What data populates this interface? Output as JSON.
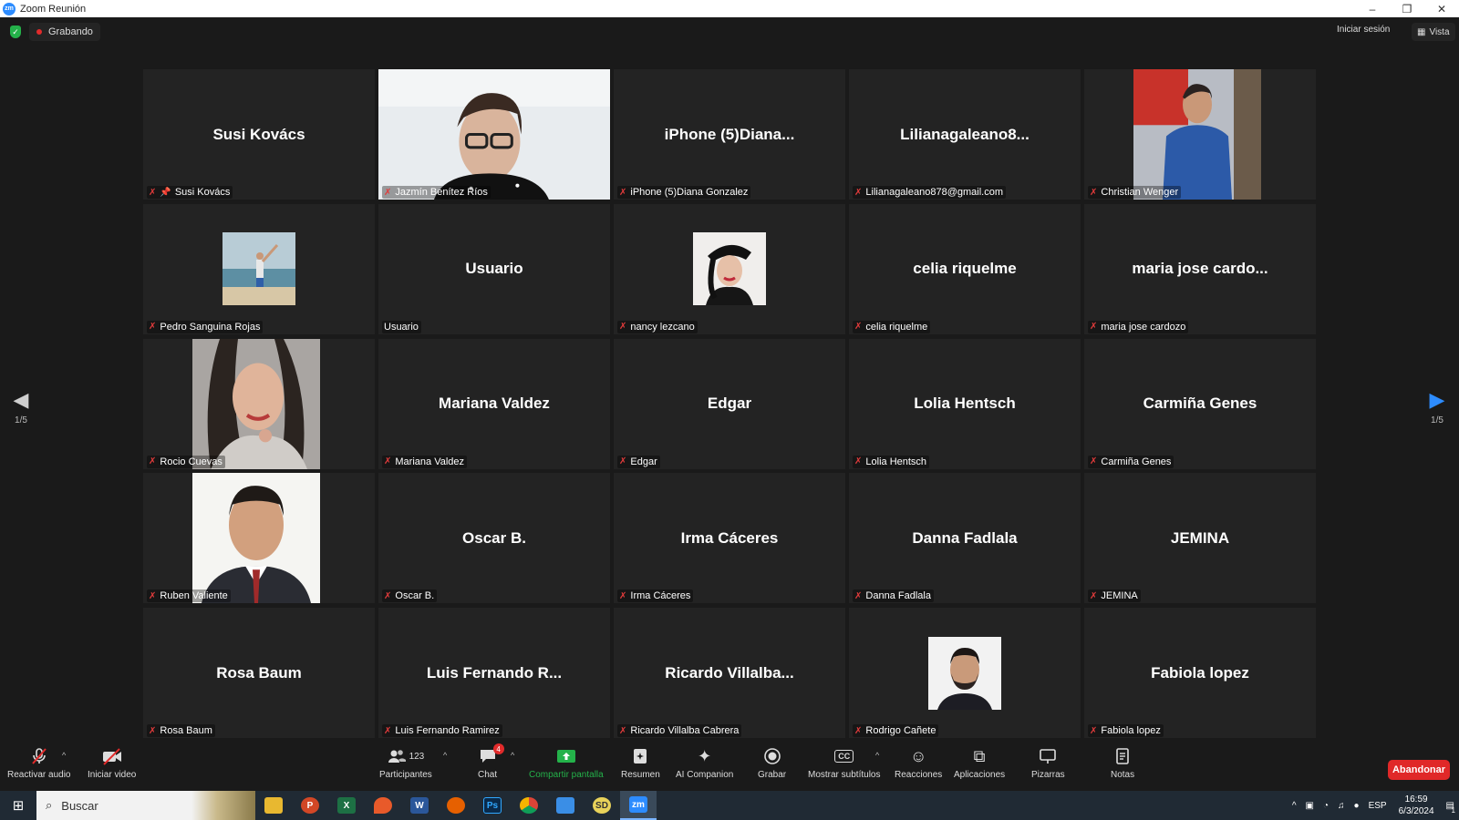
{
  "window": {
    "title": "Zoom Reunión",
    "logo_text": "zm",
    "controls": [
      "–",
      "❐",
      "✕"
    ]
  },
  "topbar": {
    "recording_label": "Grabando",
    "signin_label": "Iniciar sesión",
    "view_label": "Vista"
  },
  "pagination": {
    "left": "1/5",
    "right": "1/5"
  },
  "tiles": [
    {
      "big": "Susi Kovács",
      "label": "Susi Kovács",
      "pinned": true
    },
    {
      "big": "",
      "label": "Jazmín Benítez Ríos",
      "active": true,
      "video": "woman-glasses"
    },
    {
      "big": "iPhone  (5)Diana...",
      "label": "iPhone (5)Diana Gonzalez"
    },
    {
      "big": "Lilianagaleano8...",
      "label": "Lilianagaleano878@gmail.com"
    },
    {
      "big": "",
      "label": "Christian Wenger",
      "video": "man-blue-shirt"
    },
    {
      "big": "",
      "label": "Pedro Sanguina Rojas",
      "avatar": "beach"
    },
    {
      "big": "Usuario",
      "label": "Usuario",
      "nomic": true
    },
    {
      "big": "",
      "label": "nancy lezcano",
      "avatar": "woman-hat"
    },
    {
      "big": "celia riquelme",
      "label": "celia riquelme"
    },
    {
      "big": "maria jose cardo...",
      "label": "maria jose cardozo"
    },
    {
      "big": "",
      "label": "Rocio Cuevas",
      "video": "woman-selfie"
    },
    {
      "big": "Mariana Valdez",
      "label": "Mariana Valdez"
    },
    {
      "big": "Edgar",
      "label": "Edgar"
    },
    {
      "big": "Lolia Hentsch",
      "label": "Lolia Hentsch"
    },
    {
      "big": "Carmiña Genes",
      "label": "Carmiña Genes"
    },
    {
      "big": "",
      "label": "Ruben Valiente",
      "video": "man-suit"
    },
    {
      "big": "Oscar B.",
      "label": "Oscar B."
    },
    {
      "big": "Irma  Cáceres",
      "label": "Irma  Cáceres"
    },
    {
      "big": "Danna Fadlala",
      "label": "Danna Fadlala"
    },
    {
      "big": "JEMINA",
      "label": "JEMINA"
    },
    {
      "big": "Rosa Baum",
      "label": "Rosa Baum"
    },
    {
      "big": "Luis Fernando R...",
      "label": "Luis Fernando Ramirez"
    },
    {
      "big": "Ricardo Villalba...",
      "label": "Ricardo Villalba Cabrera"
    },
    {
      "big": "",
      "label": "Rodrigo Cañete",
      "avatar": "man-beard"
    },
    {
      "big": "Fabiola lopez",
      "label": "Fabiola lopez"
    }
  ],
  "toolbar": {
    "audio": "Reactivar audio",
    "video": "Iniciar video",
    "participants": "Participantes",
    "participants_count": "123",
    "chat": "Chat",
    "chat_badge": "4",
    "share": "Compartir pantalla",
    "summary": "Resumen",
    "ai": "AI Companion",
    "record": "Grabar",
    "captions": "Mostrar subtítulos",
    "captions_icon": "CC",
    "reactions": "Reacciones",
    "apps": "Aplicaciones",
    "whiteboards": "Pizarras",
    "notes": "Notas",
    "leave": "Abandonar",
    "accent_green": "#24b24a",
    "leave_red": "#e02828"
  },
  "taskbar": {
    "search_placeholder": "Buscar",
    "lang": "ESP",
    "time": "16:59",
    "date": "6/3/2024",
    "notif_count": "1"
  }
}
